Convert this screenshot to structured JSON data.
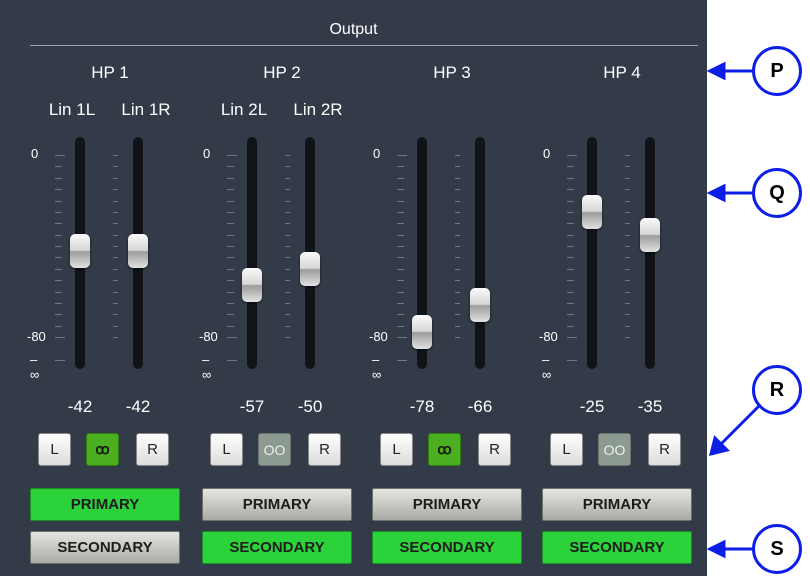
{
  "title": "Output",
  "groups": [
    {
      "name": "HP 1",
      "channels": [
        "Lin 1L",
        "Lin 1R"
      ],
      "values": [
        "-42",
        "-42"
      ],
      "link": "linked",
      "link_glyph": "ꝏ",
      "left_label": "L",
      "right_label": "R",
      "primary_active": true,
      "secondary_active": false
    },
    {
      "name": "HP 2",
      "channels": [
        "Lin 2L",
        "Lin 2R"
      ],
      "values": [
        "-57",
        "-50"
      ],
      "link": "unlinked",
      "link_glyph": "OO",
      "left_label": "L",
      "right_label": "R",
      "primary_active": false,
      "secondary_active": true
    },
    {
      "name": "HP 3",
      "channels": [],
      "values": [
        "-78",
        "-66"
      ],
      "link": "linked",
      "link_glyph": "ꝏ",
      "left_label": "L",
      "right_label": "R",
      "primary_active": false,
      "secondary_active": true
    },
    {
      "name": "HP 4",
      "channels": [],
      "values": [
        "-25",
        "-35"
      ],
      "link": "unlinked",
      "link_glyph": "OO",
      "left_label": "L",
      "right_label": "R",
      "primary_active": false,
      "secondary_active": true
    }
  ],
  "scale": {
    "top": "0",
    "bottom": "-80",
    "min": "–∞"
  },
  "modes": {
    "primary": "PRIMARY",
    "secondary": "SECONDARY"
  },
  "callouts": [
    "P",
    "Q",
    "R",
    "S"
  ],
  "colors": {
    "panel": "#323b47",
    "active_green": "#2bd23a",
    "link_green": "#4caf1f",
    "callout_blue": "#0d1fe6"
  }
}
